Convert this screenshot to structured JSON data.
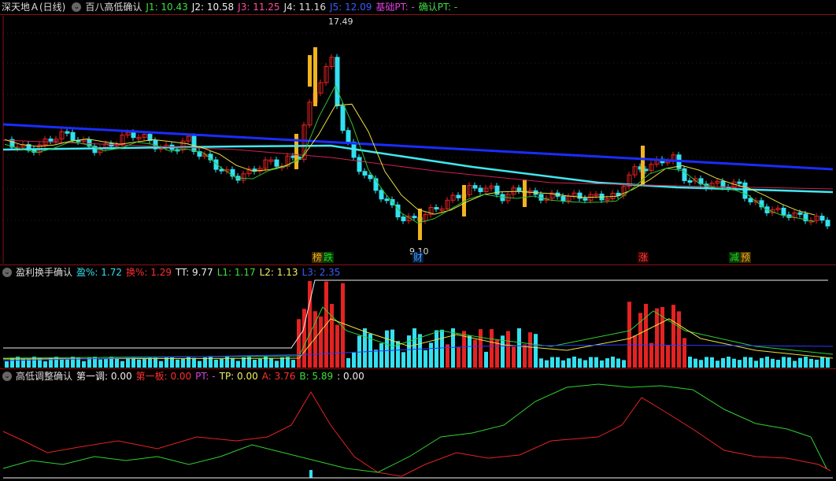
{
  "colors": {
    "bg": "#000000",
    "up": "#e52222",
    "down": "#33e0f0",
    "gold": "#f0b420",
    "sep": "#8b1111"
  },
  "main_header": {
    "stock": "深天地Ａ(日线)",
    "indicator": "百八高低确认",
    "j1": "J1: 10.43",
    "j2": "J2: 10.58",
    "j3": "J3: 11.25",
    "j4": "J4: 11.16",
    "j5": "J5: 12.09",
    "base_pt": "基础PT: -",
    "confirm_pt": "确认PT: -"
  },
  "main_labels": {
    "high": "17.49",
    "low": "9.10"
  },
  "tags": [
    {
      "text": "榜",
      "color": "#f0b420",
      "bg": "#3a2a00"
    },
    {
      "text": "跌",
      "color": "#30d030",
      "bg": "#003a00"
    },
    {
      "text": "财",
      "color": "#4aa0ff",
      "bg": "#001a3a"
    },
    {
      "text": "涨",
      "color": "#ff4040",
      "bg": "#3a0000"
    },
    {
      "text": "减",
      "color": "#30d030",
      "bg": "#003a00"
    },
    {
      "text": "预",
      "color": "#f0b420",
      "bg": "#3a2a00"
    }
  ],
  "mid_header": {
    "indicator": "盈利换手确认",
    "profit": "盈%: 1.72",
    "turnover": "换%: 1.29",
    "tt": "TT: 9.77",
    "l1": "L1: 1.17",
    "l2": "L2: 1.13",
    "l3": "L3: 2.35"
  },
  "bot_header": {
    "indicator": "高低调整确认",
    "first": "第一调: 0.00",
    "board": "第一板: 0.00",
    "pt": "PT: -",
    "tp": "TP: 0.00",
    "a": "A: 3.76",
    "b": "B: 5.89",
    "extra": ": 0.00"
  }
}
